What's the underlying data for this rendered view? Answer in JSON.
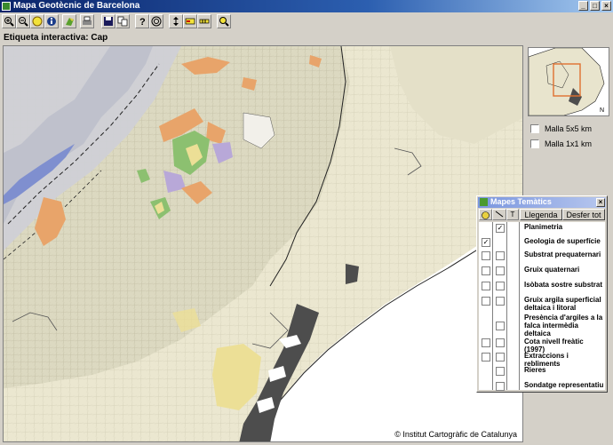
{
  "window": {
    "title": "Mapa Geotècnic de Barcelona",
    "controls": {
      "minimize": "_",
      "maximize": "□",
      "close": "×"
    }
  },
  "toolbar": {
    "buttons": [
      {
        "name": "zoom-in-icon",
        "glyph": "+"
      },
      {
        "name": "zoom-out-icon",
        "glyph": "−"
      },
      {
        "name": "pan-hand-icon",
        "glyph": "✋"
      },
      {
        "name": "info-icon",
        "glyph": "i"
      },
      {
        "name": "layers-icon",
        "glyph": ""
      },
      {
        "name": "print-icon",
        "glyph": ""
      },
      {
        "name": "save-icon",
        "glyph": ""
      },
      {
        "name": "copy-icon",
        "glyph": ""
      },
      {
        "name": "help-icon",
        "glyph": "?"
      },
      {
        "name": "target-icon",
        "glyph": "◎"
      },
      {
        "name": "measure-icon",
        "glyph": ""
      },
      {
        "name": "label-icon",
        "glyph": ""
      },
      {
        "name": "scale-icon",
        "glyph": ""
      },
      {
        "name": "search-icon",
        "glyph": ""
      }
    ]
  },
  "status": {
    "interactive_label": "Etiqueta interactiva: Cap"
  },
  "map": {
    "copyright": "© Institut Cartogràfic de Catalunya"
  },
  "grid_options": [
    {
      "label": "Malla 5x5 km",
      "checked": false
    },
    {
      "label": "Malla 1x1 km",
      "checked": false
    }
  ],
  "themes": {
    "title": "Mapes Temàtics",
    "col_t": "T",
    "legend_button": "Llegenda",
    "undo_button": "Desfer tot",
    "rows": [
      {
        "label": "Planimetria",
        "c1": false,
        "c2": true,
        "c1_visible": false
      },
      {
        "label": "Geologia de superfície",
        "c1": true,
        "c2": false
      },
      {
        "label": "Substrat prequaternari",
        "c1": false,
        "c2": false
      },
      {
        "label": "Gruix quaternari",
        "c1": false,
        "c2": false
      },
      {
        "label": "Isòbata sostre substrat",
        "c1": false,
        "c2": false
      },
      {
        "label": "Gruix argila superficial deltaica i litoral",
        "c1": false,
        "c2": false
      },
      {
        "label": "Presència d'argiles a la falca intermèdia deltaica",
        "c1": false,
        "c2": false,
        "c1_visible": false
      },
      {
        "label": "Cota nivell freàtic (1997)",
        "c1": false,
        "c2": false
      },
      {
        "label": "Extraccions i rebliments",
        "c1": false,
        "c2": false
      },
      {
        "label": "Rieres",
        "c1": false,
        "c2": false,
        "c1_visible": false
      },
      {
        "label": "Sondatge representatiu",
        "c1": false,
        "c2": false,
        "c1_visible": false
      }
    ]
  },
  "colors": {
    "urban_fill": "#dedbc3",
    "delta_fill": "#ece8d2",
    "sea": "#ffffff",
    "mountain": "#c8c9d2",
    "accent_orange": "#e8a46a",
    "accent_green": "#8cc070",
    "accent_yellow": "#ecdf96",
    "accent_purple": "#b8a8d8",
    "port_gray": "#4d4d4d"
  }
}
